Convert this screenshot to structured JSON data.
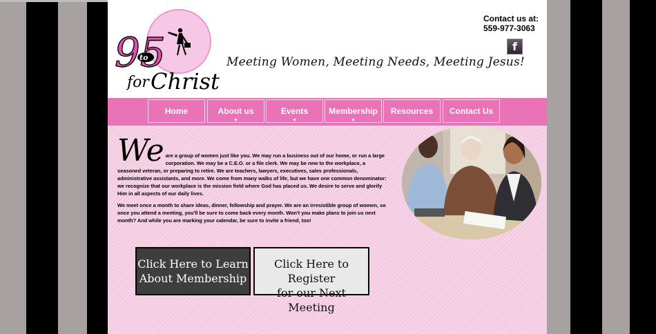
{
  "header": {
    "logo": {
      "numeral": "95",
      "small_word": "to",
      "word_for": "for",
      "word_christ": "Christ"
    },
    "tagline": "Meeting Women, Meeting Needs, Meeting Jesus!",
    "contact_label": "Contact us at:",
    "contact_phone": "559-977-3063",
    "facebook_glyph": "f"
  },
  "nav": {
    "items": [
      {
        "label": "Home"
      },
      {
        "label": "About us"
      },
      {
        "label": "Events"
      },
      {
        "label": "Membership"
      },
      {
        "label": "Resources"
      },
      {
        "label": "Contact Us"
      }
    ],
    "chevron": "▾"
  },
  "main": {
    "drop_cap": "We",
    "paragraph1": "are a group of women just like you. We may run a business out of our home, or run a large corporation. We may be a C.E.O. or a file clerk. We may be new to the workplace, a seasoned veteran, or preparing to retire. We are teachers, lawyers, executives, sales professionals, administrative assistants, and more. We come from many walks of life, but we have one common denominator: we recognize that our workplace is the mission field where God has placed us. We desire to serve and glorify Him in all aspects of our daily lives.",
    "paragraph2": "We meet once a month to share ideas, dinner, fellowship and prayer. We are an irresistible group of women, so once you attend a meeting, you'll be sure to come back every month. Won't you make plans to join us next month? And while you are marking your calendar, be sure to invite a friend, too!",
    "cta_membership_line1": "Click Here to Learn",
    "cta_membership_line2": "About Membership",
    "cta_register_line1": "Click Here to Register",
    "cta_register_line2": "for our Next Meeting"
  },
  "colors": {
    "nav_pink": "#ea73b7",
    "content_pink": "#f5cfe3",
    "logo_pink": "#e052b0"
  },
  "icons": {
    "social": "facebook-icon"
  }
}
